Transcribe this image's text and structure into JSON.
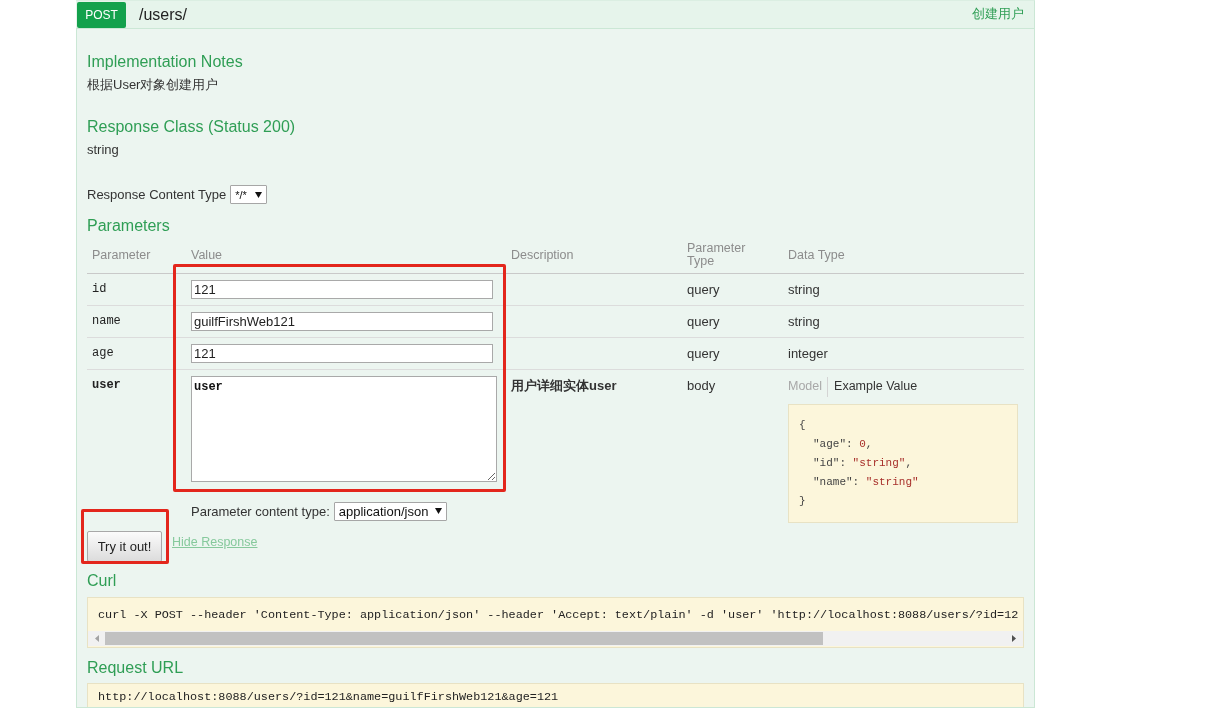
{
  "operation": {
    "method": "POST",
    "path": "/users/",
    "summary": "创建用户"
  },
  "implementation_notes": {
    "title": "Implementation Notes",
    "text": "根据User对象创建用户"
  },
  "response_class": {
    "title": "Response Class (Status 200)",
    "type": "string"
  },
  "response_content_type": {
    "label": "Response Content Type",
    "value": "*/*"
  },
  "parameters": {
    "title": "Parameters",
    "highlighted": true,
    "columns": [
      "Parameter",
      "Value",
      "Description",
      "Parameter Type",
      "Data Type"
    ],
    "rows": [
      {
        "name": "id",
        "required": false,
        "kind": "input",
        "value": "121",
        "parameter_type": "query",
        "data_type": "string"
      },
      {
        "name": "name",
        "required": false,
        "kind": "input",
        "value": "guilfFirshWeb121",
        "parameter_type": "query",
        "data_type": "string"
      },
      {
        "name": "age",
        "required": false,
        "kind": "input",
        "value": "121",
        "parameter_type": "query",
        "data_type": "integer"
      },
      {
        "name": "user",
        "required": true,
        "kind": "textarea",
        "value": "user",
        "description": "用户详细实体user",
        "parameter_type": "body",
        "content_type": {
          "label": "Parameter content type:",
          "value": "application/json"
        },
        "sample": {
          "tabs": [
            {
              "label": "Model",
              "selected": false
            },
            {
              "label": "Example Value",
              "selected": true
            }
          ],
          "open": "{",
          "lines": [
            "\"age\": 0,",
            "\"id\": \"string\",",
            "\"name\": \"string\""
          ],
          "close": "}"
        }
      }
    ]
  },
  "try_button": {
    "label": "Try it out!",
    "highlighted": true
  },
  "hide_response_link": "Hide Response",
  "curl": {
    "title": "Curl",
    "command": "curl -X POST --header 'Content-Type: application/json' --header 'Accept: text/plain' -d 'user' 'http://localhost:8088/users/?id=12"
  },
  "request_url": {
    "title": "Request URL",
    "url": "http://localhost:8088/users/?id=121&name=guilfFirshWeb121&age=121"
  }
}
